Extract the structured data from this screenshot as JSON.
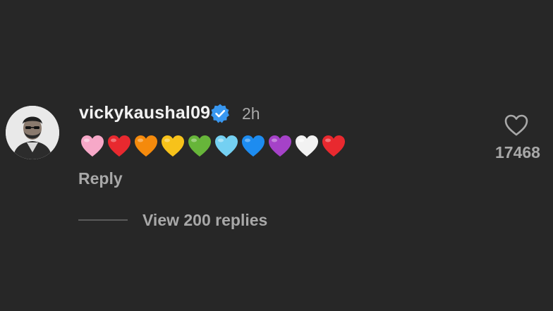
{
  "comment": {
    "username": "vickykaushal09",
    "verified": true,
    "time": "2h",
    "body_emoji": [
      "pink-heart",
      "red-heart",
      "orange-heart",
      "yellow-heart",
      "green-heart",
      "light-blue-heart",
      "blue-heart",
      "purple-heart",
      "white-heart",
      "red-heart"
    ],
    "reply_label": "Reply",
    "view_replies_label": "View 200 replies",
    "like_count": "17468"
  },
  "icons": {
    "verified_badge": "verified-badge-icon",
    "like": "heart-outline-icon"
  },
  "colors": {
    "background": "#272727",
    "username": "#f2f2f2",
    "muted_text": "#a8a8a8",
    "verified": "#3897f0",
    "heart_colors": [
      "#f7a8c8",
      "#e8292f",
      "#f58a0c",
      "#f7c21a",
      "#67b53a",
      "#74d0f2",
      "#1d8cf0",
      "#a542c8",
      "#f2f2f2",
      "#e8292f"
    ]
  }
}
